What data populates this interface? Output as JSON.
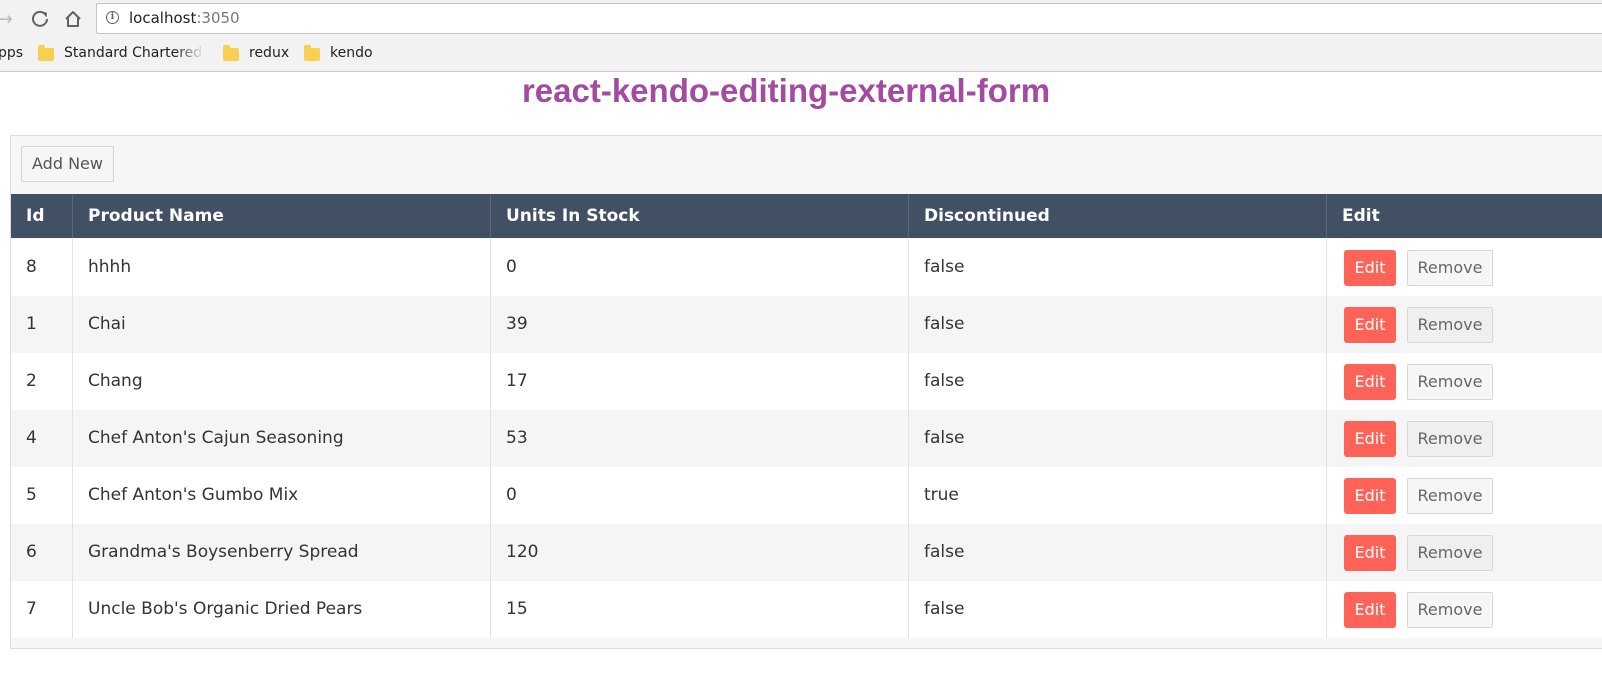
{
  "browser": {
    "url_host": "localhost",
    "url_port": ":3050",
    "bookmarks": [
      {
        "label": "pps"
      },
      {
        "label": "Standard Chartered B"
      },
      {
        "label": "redux"
      },
      {
        "label": "kendo"
      }
    ]
  },
  "page": {
    "title": "react-kendo-editing-external-form"
  },
  "grid": {
    "add_new_label": "Add New",
    "columns": [
      "Id",
      "Product Name",
      "Units In Stock",
      "Discontinued",
      "Edit"
    ],
    "edit_label": "Edit",
    "remove_label": "Remove",
    "rows": [
      {
        "id": "8",
        "name": "hhhh",
        "units": "0",
        "discontinued": "false"
      },
      {
        "id": "1",
        "name": "Chai",
        "units": "39",
        "discontinued": "false"
      },
      {
        "id": "2",
        "name": "Chang",
        "units": "17",
        "discontinued": "false"
      },
      {
        "id": "4",
        "name": "Chef Anton's Cajun Seasoning",
        "units": "53",
        "discontinued": "false"
      },
      {
        "id": "5",
        "name": "Chef Anton's Gumbo Mix",
        "units": "0",
        "discontinued": "true"
      },
      {
        "id": "6",
        "name": "Grandma's Boysenberry Spread",
        "units": "120",
        "discontinued": "false"
      },
      {
        "id": "7",
        "name": "Uncle Bob's Organic Dried Pears",
        "units": "15",
        "discontinued": "false"
      }
    ]
  },
  "colors": {
    "title": "#a24ba0",
    "header_bg": "#425066",
    "edit_button": "#ff6358"
  }
}
